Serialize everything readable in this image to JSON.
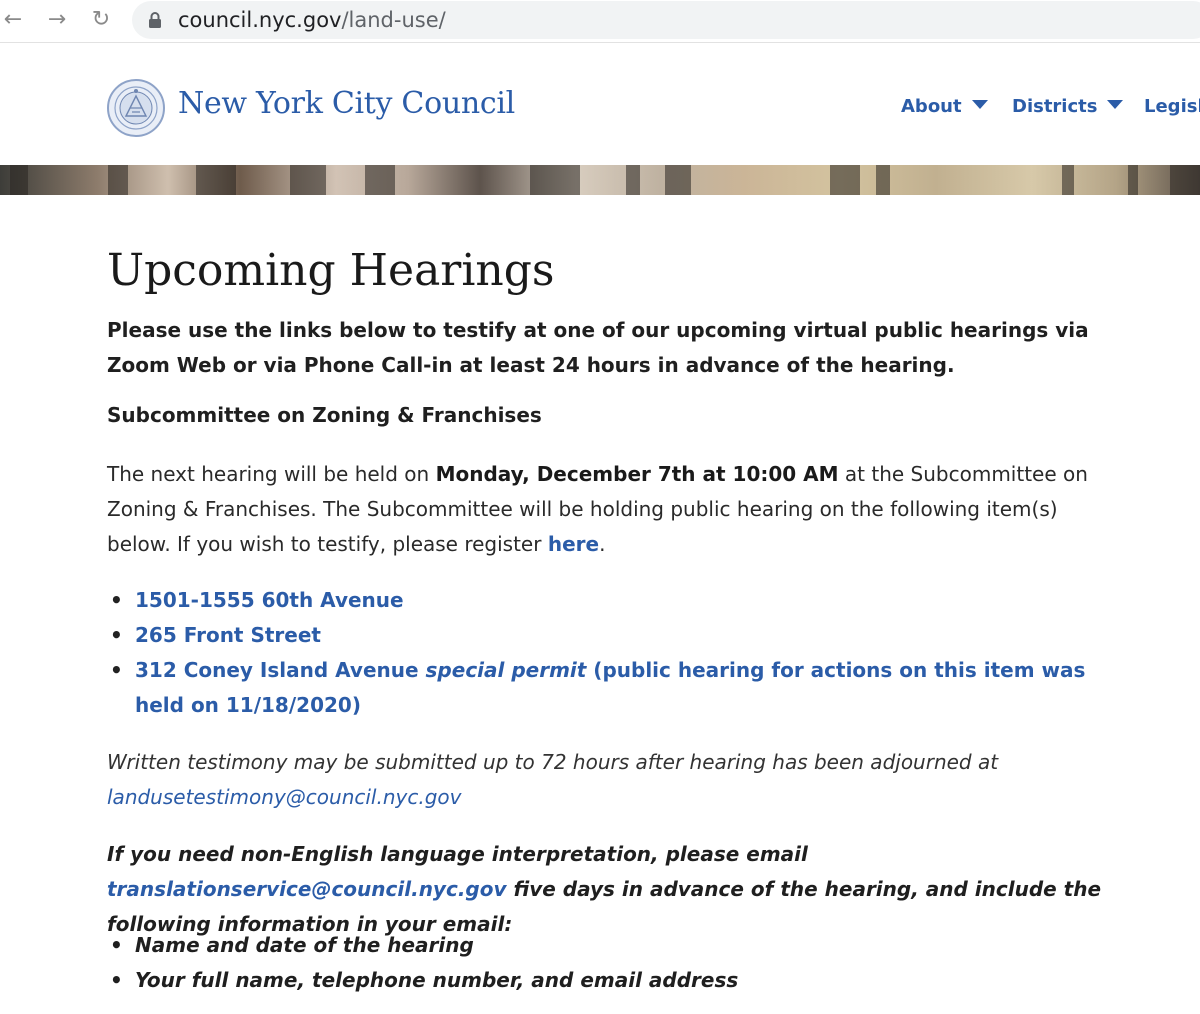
{
  "browser": {
    "url_host": "council.nyc.gov",
    "url_path": "/land-use/"
  },
  "site": {
    "title": "New York City Council",
    "nav": [
      {
        "label": "About"
      },
      {
        "label": "Districts"
      },
      {
        "label": "Legisla"
      }
    ]
  },
  "page": {
    "title": "Upcoming Hearings",
    "lead": "Please use the links below to testify at one of our upcoming virtual public hearings via Zoom Web or via Phone Call-in at least 24 hours in advance of the hearing.",
    "subcommittee": "Subcommittee on Zoning & Franchises",
    "hearing_text_1": "The next hearing will be held on ",
    "hearing_date": "Monday, December 7th at 10:00 AM",
    "hearing_text_2": " at the Subcommittee on Zoning & Franchises. The Subcommittee will be holding public hearing on the following item(s) below. If you wish to testify, please register ",
    "register_link": "here",
    "hearing_text_3": ".",
    "items": [
      {
        "link": "1501-1555 60th Avenue"
      },
      {
        "link": "265 Front Street"
      },
      {
        "link": "312 Coney Island Avenue ",
        "link_italic": "special permit",
        "link_tail": " (public hearing for actions on this item was held on 11/18/2020)"
      }
    ],
    "written_text": "Written testimony may be submitted up to 72 hours after hearing has been adjourned at ",
    "written_email": "landusetestimony@council.nyc.gov",
    "interp_text_1": "If you need non-English language interpretation, please email ",
    "interp_email": "translationservice@council.nyc.gov",
    "interp_text_2": " five days in advance of the hearing, and include the following information in your email:",
    "info_items": [
      "Name and date of the hearing",
      "Your full name, telephone number, and email address"
    ]
  },
  "colors": {
    "link": "#2b5ca8",
    "text": "#1f1f1f"
  }
}
